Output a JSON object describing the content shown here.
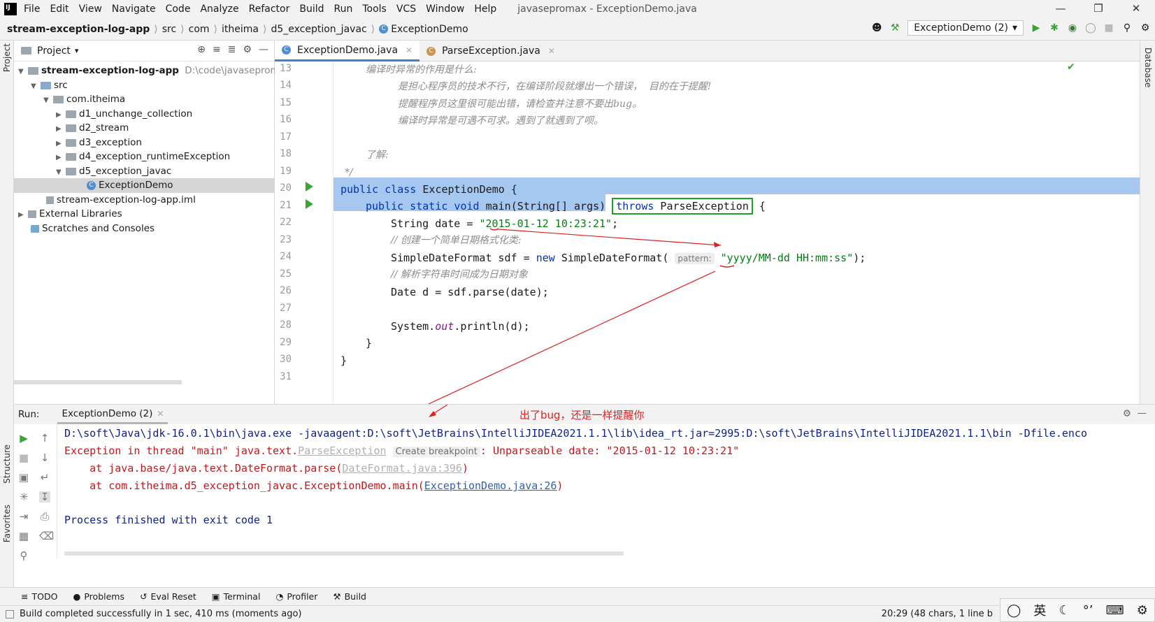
{
  "titlebar": {
    "menu": [
      "File",
      "Edit",
      "View",
      "Navigate",
      "Code",
      "Analyze",
      "Refactor",
      "Build",
      "Run",
      "Tools",
      "VCS",
      "Window",
      "Help"
    ],
    "window_title": "javasepromax - ExceptionDemo.java"
  },
  "navbar": {
    "crumbs": [
      "stream-exception-log-app",
      "src",
      "com",
      "itheima",
      "d5_exception_javac",
      "ExceptionDemo"
    ],
    "run_config": "ExceptionDemo (2)"
  },
  "sidebar": {
    "left_labels": [
      "Project",
      "Structure",
      "Favorites"
    ],
    "right_labels": [
      "Database"
    ]
  },
  "project": {
    "title": "Project",
    "root": "stream-exception-log-app",
    "root_path": "D:\\code\\javasepromax",
    "src": "src",
    "package": "com.itheima",
    "folders": [
      "d1_unchange_collection",
      "d2_stream",
      "d3_exception",
      "d4_exception_runtimeException",
      "d5_exception_javac"
    ],
    "selected_file": "ExceptionDemo",
    "iml": "stream-exception-log-app.iml",
    "external_libraries": "External Libraries",
    "scratches": "Scratches and Consoles"
  },
  "editor": {
    "tabs": [
      "ExceptionDemo.java",
      "ParseException.java"
    ],
    "line_numbers": [
      "13",
      "14",
      "15",
      "16",
      "17",
      "18",
      "19",
      "20",
      "21",
      "22",
      "23",
      "24",
      "25",
      "26",
      "27",
      "28",
      "29",
      "30",
      "31"
    ],
    "comments": {
      "l13": "编译时异常的作用是什么:",
      "l14": "是担心程序员的技术不行，在编译阶段就爆出一个错误，  目的在于提醒!",
      "l15": "提醒程序员这里很可能出错，请检查并注意不要出bug。",
      "l16": "编译时异常是可遇不可求。遇到了就遇到了呗。",
      "l18": "了解:",
      "l19": "*/",
      "l23": "// 创建一个简单日期格式化类:",
      "l25": "// 解析字符串时间成为日期对象"
    },
    "code": {
      "l20_kw": "public class",
      "l20_name": " ExceptionDemo {",
      "l21_kw": "public static void",
      "l21_rest": " main(String[] args) ",
      "l21_throws": "throws",
      "l21_exc": " ParseException",
      "l21_brace": " {",
      "l22_a": "String date = ",
      "l22_str": "\"2015-01-12 10:23:21\"",
      "l22_end": ";",
      "l24_a": "SimpleDateFormat sdf = ",
      "l24_new": "new",
      "l24_b": " SimpleDateFormat( ",
      "l24_hint": "pattern:",
      "l24_str": " \"yyyy/MM-dd HH:mm:ss\"",
      "l24_end": ");",
      "l26": "Date d = sdf.parse(date);",
      "l28_a": "System.",
      "l28_out": "out",
      "l28_b": ".println(d);",
      "l29": "}",
      "l30": "}"
    }
  },
  "run": {
    "label": "Run:",
    "tab": "ExceptionDemo (2)",
    "annotation": "出了bug，还是一样提醒你",
    "lines": {
      "cmd": "D:\\soft\\Java\\jdk-16.0.1\\bin\\java.exe -javaagent:D:\\soft\\JetBrains\\IntelliJIDEA2021.1.1\\lib\\idea_rt.jar=2995:D:\\soft\\JetBrains\\IntelliJIDEA2021.1.1\\bin -Dfile.enco",
      "exc_a": "Exception in thread \"main\" java.text.",
      "exc_link": "ParseException",
      "exc_bp": "Create breakpoint",
      "exc_b": ": Unparseable date: \"2015-01-12 10:23:21\"",
      "at1_a": "    at java.base/java.text.DateFormat.parse(",
      "at1_link": "DateFormat.java:396",
      "at1_b": ")",
      "at2_a": "    at com.itheima.d5_exception_javac.ExceptionDemo.main(",
      "at2_link": "ExceptionDemo.java:26",
      "at2_b": ")",
      "exit": "Process finished with exit code 1"
    }
  },
  "bottom_tools": [
    "TODO",
    "Problems",
    "Eval Reset",
    "Terminal",
    "Profiler",
    "Build"
  ],
  "status": {
    "message": "Build completed successfully in 1 sec, 410 ms (moments ago)",
    "position": "20:29 (48 chars, 1 line b"
  },
  "ime": {
    "lang": "英"
  },
  "colors": {
    "accent": "#4083c9",
    "highlight_box": "#20a020",
    "annotation": "#e02020",
    "selection": "#a6c8f0"
  }
}
